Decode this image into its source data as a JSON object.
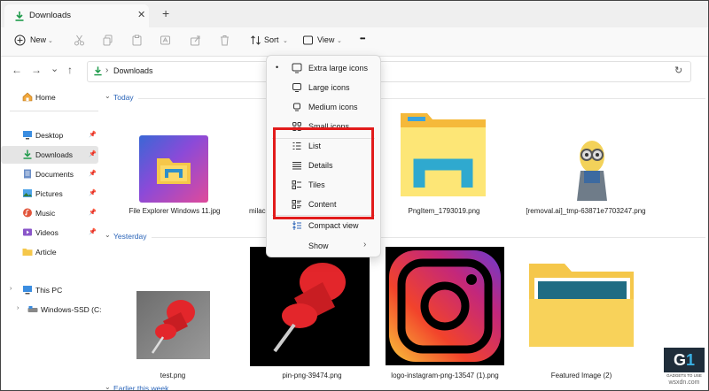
{
  "window": {
    "tab_title": "Downloads",
    "close_glyph": "✕",
    "new_tab_glyph": "+"
  },
  "toolbar": {
    "new_label": "New",
    "sort_label": "Sort",
    "view_label": "View",
    "more_glyph": "•••"
  },
  "address": {
    "crumb": "Downloads",
    "separator": "›"
  },
  "sidebar": {
    "home": "Home",
    "items": [
      {
        "label": "Desktop",
        "icon": "desktop-icon",
        "pinned": true
      },
      {
        "label": "Downloads",
        "icon": "downloads-icon",
        "pinned": true,
        "selected": true
      },
      {
        "label": "Documents",
        "icon": "documents-icon",
        "pinned": true
      },
      {
        "label": "Pictures",
        "icon": "pictures-icon",
        "pinned": true
      },
      {
        "label": "Music",
        "icon": "music-icon",
        "pinned": true
      },
      {
        "label": "Videos",
        "icon": "videos-icon",
        "pinned": true
      },
      {
        "label": "Article",
        "icon": "folder-icon",
        "pinned": false
      }
    ],
    "this_pc": "This PC",
    "drive": "Windows-SSD (C:"
  },
  "groups": {
    "today": "Today",
    "yesterday": "Yesterday",
    "earlier": "Earlier this week"
  },
  "files": {
    "today": [
      "File Explorer Windows 11.jpg",
      "milac",
      "PngItem_1793019.png",
      "[removal.ai]_tmp-63871e7703247.png"
    ],
    "yesterday": [
      "test.png",
      "pin-png-39474.png",
      "logo-instagram-png-13547 (1).png",
      "Featured Image (2)"
    ]
  },
  "view_menu": {
    "items": [
      {
        "label": "Extra large icons",
        "icon": "extra-large-icons-icon",
        "checked": true
      },
      {
        "label": "Large icons",
        "icon": "large-icons-icon"
      },
      {
        "label": "Medium icons",
        "icon": "medium-icons-icon"
      },
      {
        "label": "Small icons",
        "icon": "small-icons-icon"
      },
      {
        "label": "List",
        "icon": "list-icon"
      },
      {
        "label": "Details",
        "icon": "details-icon"
      },
      {
        "label": "Tiles",
        "icon": "tiles-icon"
      },
      {
        "label": "Content",
        "icon": "content-icon"
      },
      {
        "label": "Compact view",
        "icon": "compact-view-icon"
      },
      {
        "label": "Show",
        "icon": "",
        "submenu": true
      }
    ],
    "check_glyph": "•",
    "submenu_glyph": "›"
  },
  "watermark": {
    "line1": "GADGETS TO USE",
    "line2": "wsxdn.com"
  },
  "colors": {
    "accent": "#2a64b8",
    "highlight_box": "#e21b1b",
    "folder_yellow": "#f5c74a"
  }
}
